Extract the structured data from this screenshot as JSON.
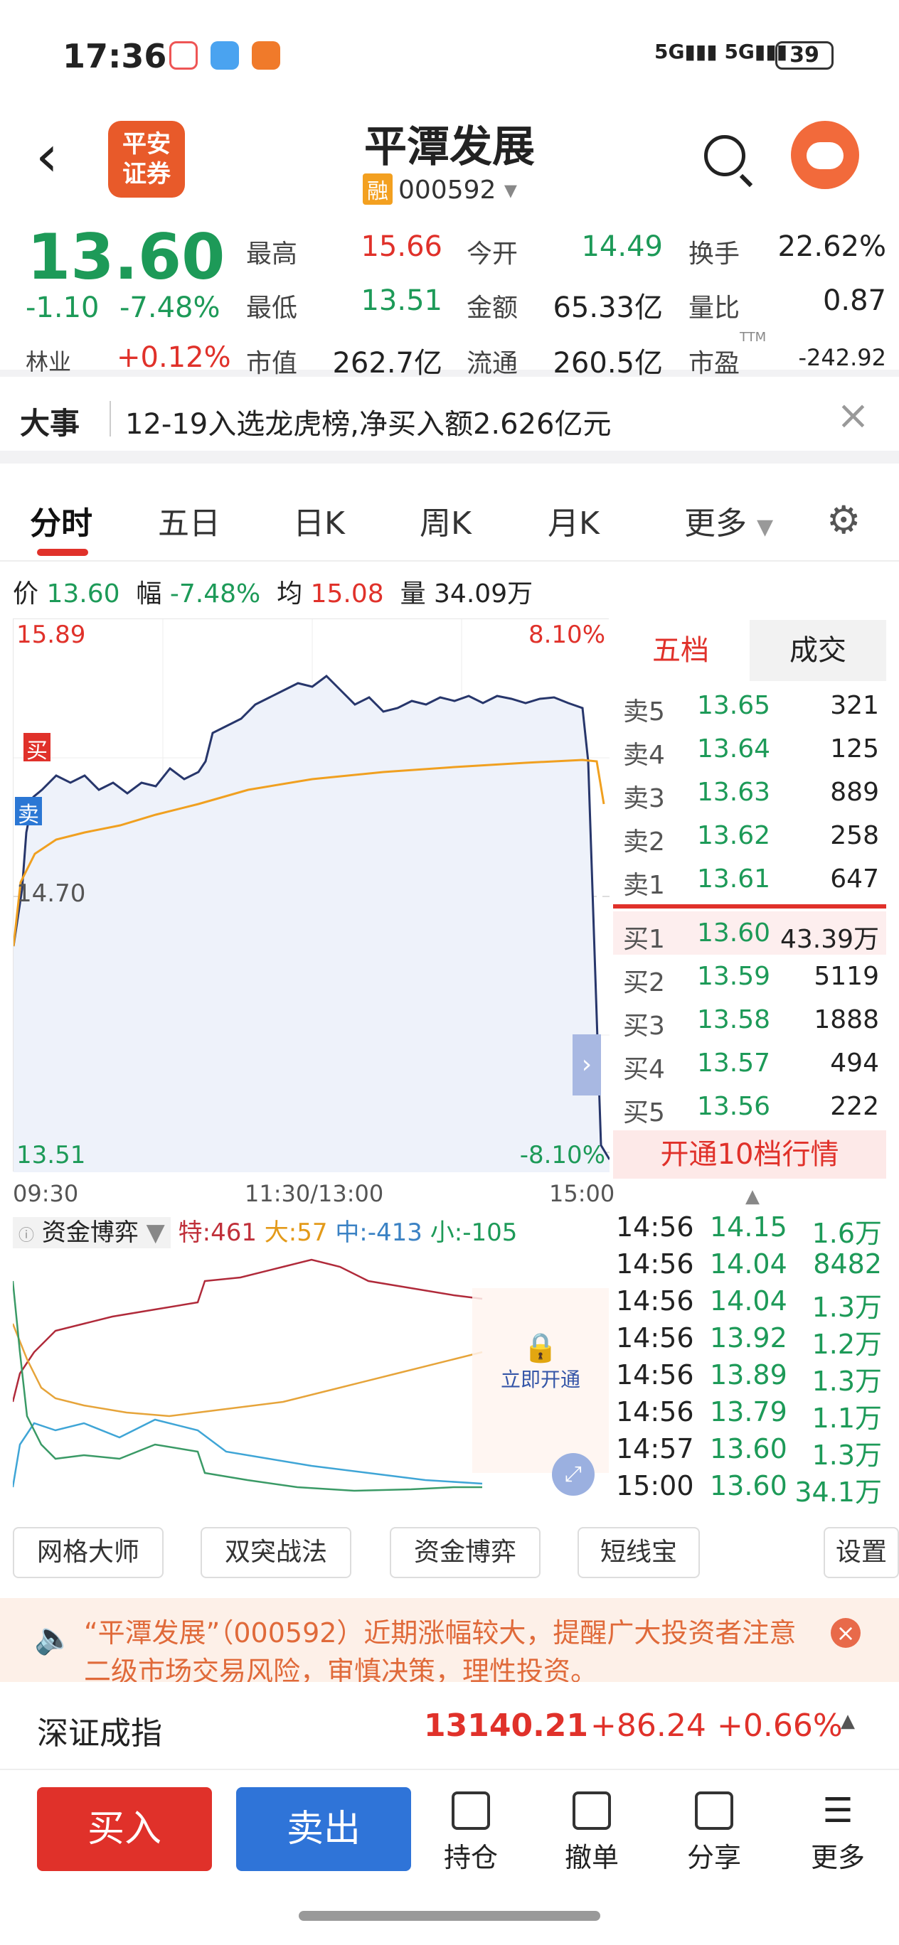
{
  "status_bar": {
    "time": "17:36",
    "signal1": "5G",
    "signal2": "5G",
    "battery": "39"
  },
  "header": {
    "logo_text_line1": "平安",
    "logo_text_line2": "证券",
    "title": "平潭发展",
    "margin_tag": "融",
    "code": "000592"
  },
  "quote": {
    "price": "13.60",
    "change": "-1.10",
    "change_pct": "-7.48%",
    "sector": "林业",
    "sector_pct": "+0.12%",
    "rows": [
      [
        {
          "l": "最高",
          "v": "15.66",
          "c": "red"
        },
        {
          "l": "今开",
          "v": "14.49",
          "c": "green"
        },
        {
          "l": "换手",
          "v": "22.62%",
          "c": "black"
        }
      ],
      [
        {
          "l": "最低",
          "v": "13.51",
          "c": "green"
        },
        {
          "l": "金额",
          "v": "65.33亿",
          "c": "black"
        },
        {
          "l": "量比",
          "v": "0.87",
          "c": "black"
        }
      ],
      [
        {
          "l": "市值",
          "v": "262.7亿",
          "c": "black"
        },
        {
          "l": "流通",
          "v": "260.5亿",
          "c": "black"
        },
        {
          "l": "市盈",
          "v": "-242.92",
          "c": "black"
        }
      ]
    ],
    "ttm": "TTM"
  },
  "news": {
    "label": "大事",
    "text": "12-19入选龙虎榜,净买入额2.626亿元"
  },
  "tabs": [
    "分时",
    "五日",
    "日K",
    "周K",
    "月K",
    "更多"
  ],
  "info": {
    "price_l": "价",
    "price": "13.60",
    "range_l": "幅",
    "range": "-7.48%",
    "avg_l": "均",
    "avg": "15.08",
    "vol_l": "量",
    "vol": "34.09万"
  },
  "chart_labels": {
    "top_price": "15.89",
    "top_pct": "8.10%",
    "mid_price": "14.70",
    "bottom_price": "13.51",
    "bottom_pct": "-8.10%",
    "buy_tag": "买",
    "sell_tag": "卖",
    "t_start": "09:30",
    "t_mid": "11:30/13:00",
    "t_end": "15:00"
  },
  "orderbook": {
    "tabs": [
      "五档",
      "成交"
    ],
    "asks": [
      {
        "l": "卖5",
        "p": "13.65",
        "v": "321"
      },
      {
        "l": "卖4",
        "p": "13.64",
        "v": "125"
      },
      {
        "l": "卖3",
        "p": "13.63",
        "v": "889"
      },
      {
        "l": "卖2",
        "p": "13.62",
        "v": "258"
      },
      {
        "l": "卖1",
        "p": "13.61",
        "v": "647"
      }
    ],
    "bids": [
      {
        "l": "买1",
        "p": "13.60",
        "v": "43.39万"
      },
      {
        "l": "买2",
        "p": "13.59",
        "v": "5119"
      },
      {
        "l": "买3",
        "p": "13.58",
        "v": "1888"
      },
      {
        "l": "买4",
        "p": "13.57",
        "v": "494"
      },
      {
        "l": "买5",
        "p": "13.56",
        "v": "222"
      }
    ],
    "upgrade": "开通10档行情"
  },
  "flow": {
    "title": "资金博弈",
    "te": "特:461",
    "da": "大:57",
    "zhong": "中:-413",
    "xiao": "小:-105",
    "unlock": "立即开通"
  },
  "ticks": [
    {
      "t": "14:56",
      "p": "14.15",
      "v": "1.6万"
    },
    {
      "t": "14:56",
      "p": "14.04",
      "v": "8482"
    },
    {
      "t": "14:56",
      "p": "14.04",
      "v": "1.3万"
    },
    {
      "t": "14:56",
      "p": "13.92",
      "v": "1.2万"
    },
    {
      "t": "14:56",
      "p": "13.89",
      "v": "1.3万"
    },
    {
      "t": "14:56",
      "p": "13.79",
      "v": "1.1万"
    },
    {
      "t": "14:57",
      "p": "13.60",
      "v": "1.3万"
    },
    {
      "t": "15:00",
      "p": "13.60",
      "v": "34.1万"
    }
  ],
  "tools": [
    "网格大师",
    "双突战法",
    "资金博弈",
    "短线宝",
    "设置"
  ],
  "warning": "“平潭发展”（000592）近期涨幅较大，提醒广大投资者注意二级市场交易风险，审慎决策，理性投资。",
  "index": {
    "name": "深证成指",
    "value": "13140.21",
    "change": "+86.24",
    "pct": "+0.66%"
  },
  "bottom": {
    "buy": "买入",
    "sell": "卖出",
    "hold": "持仓",
    "cancel": "撤单",
    "share": "分享",
    "more": "更多"
  }
}
